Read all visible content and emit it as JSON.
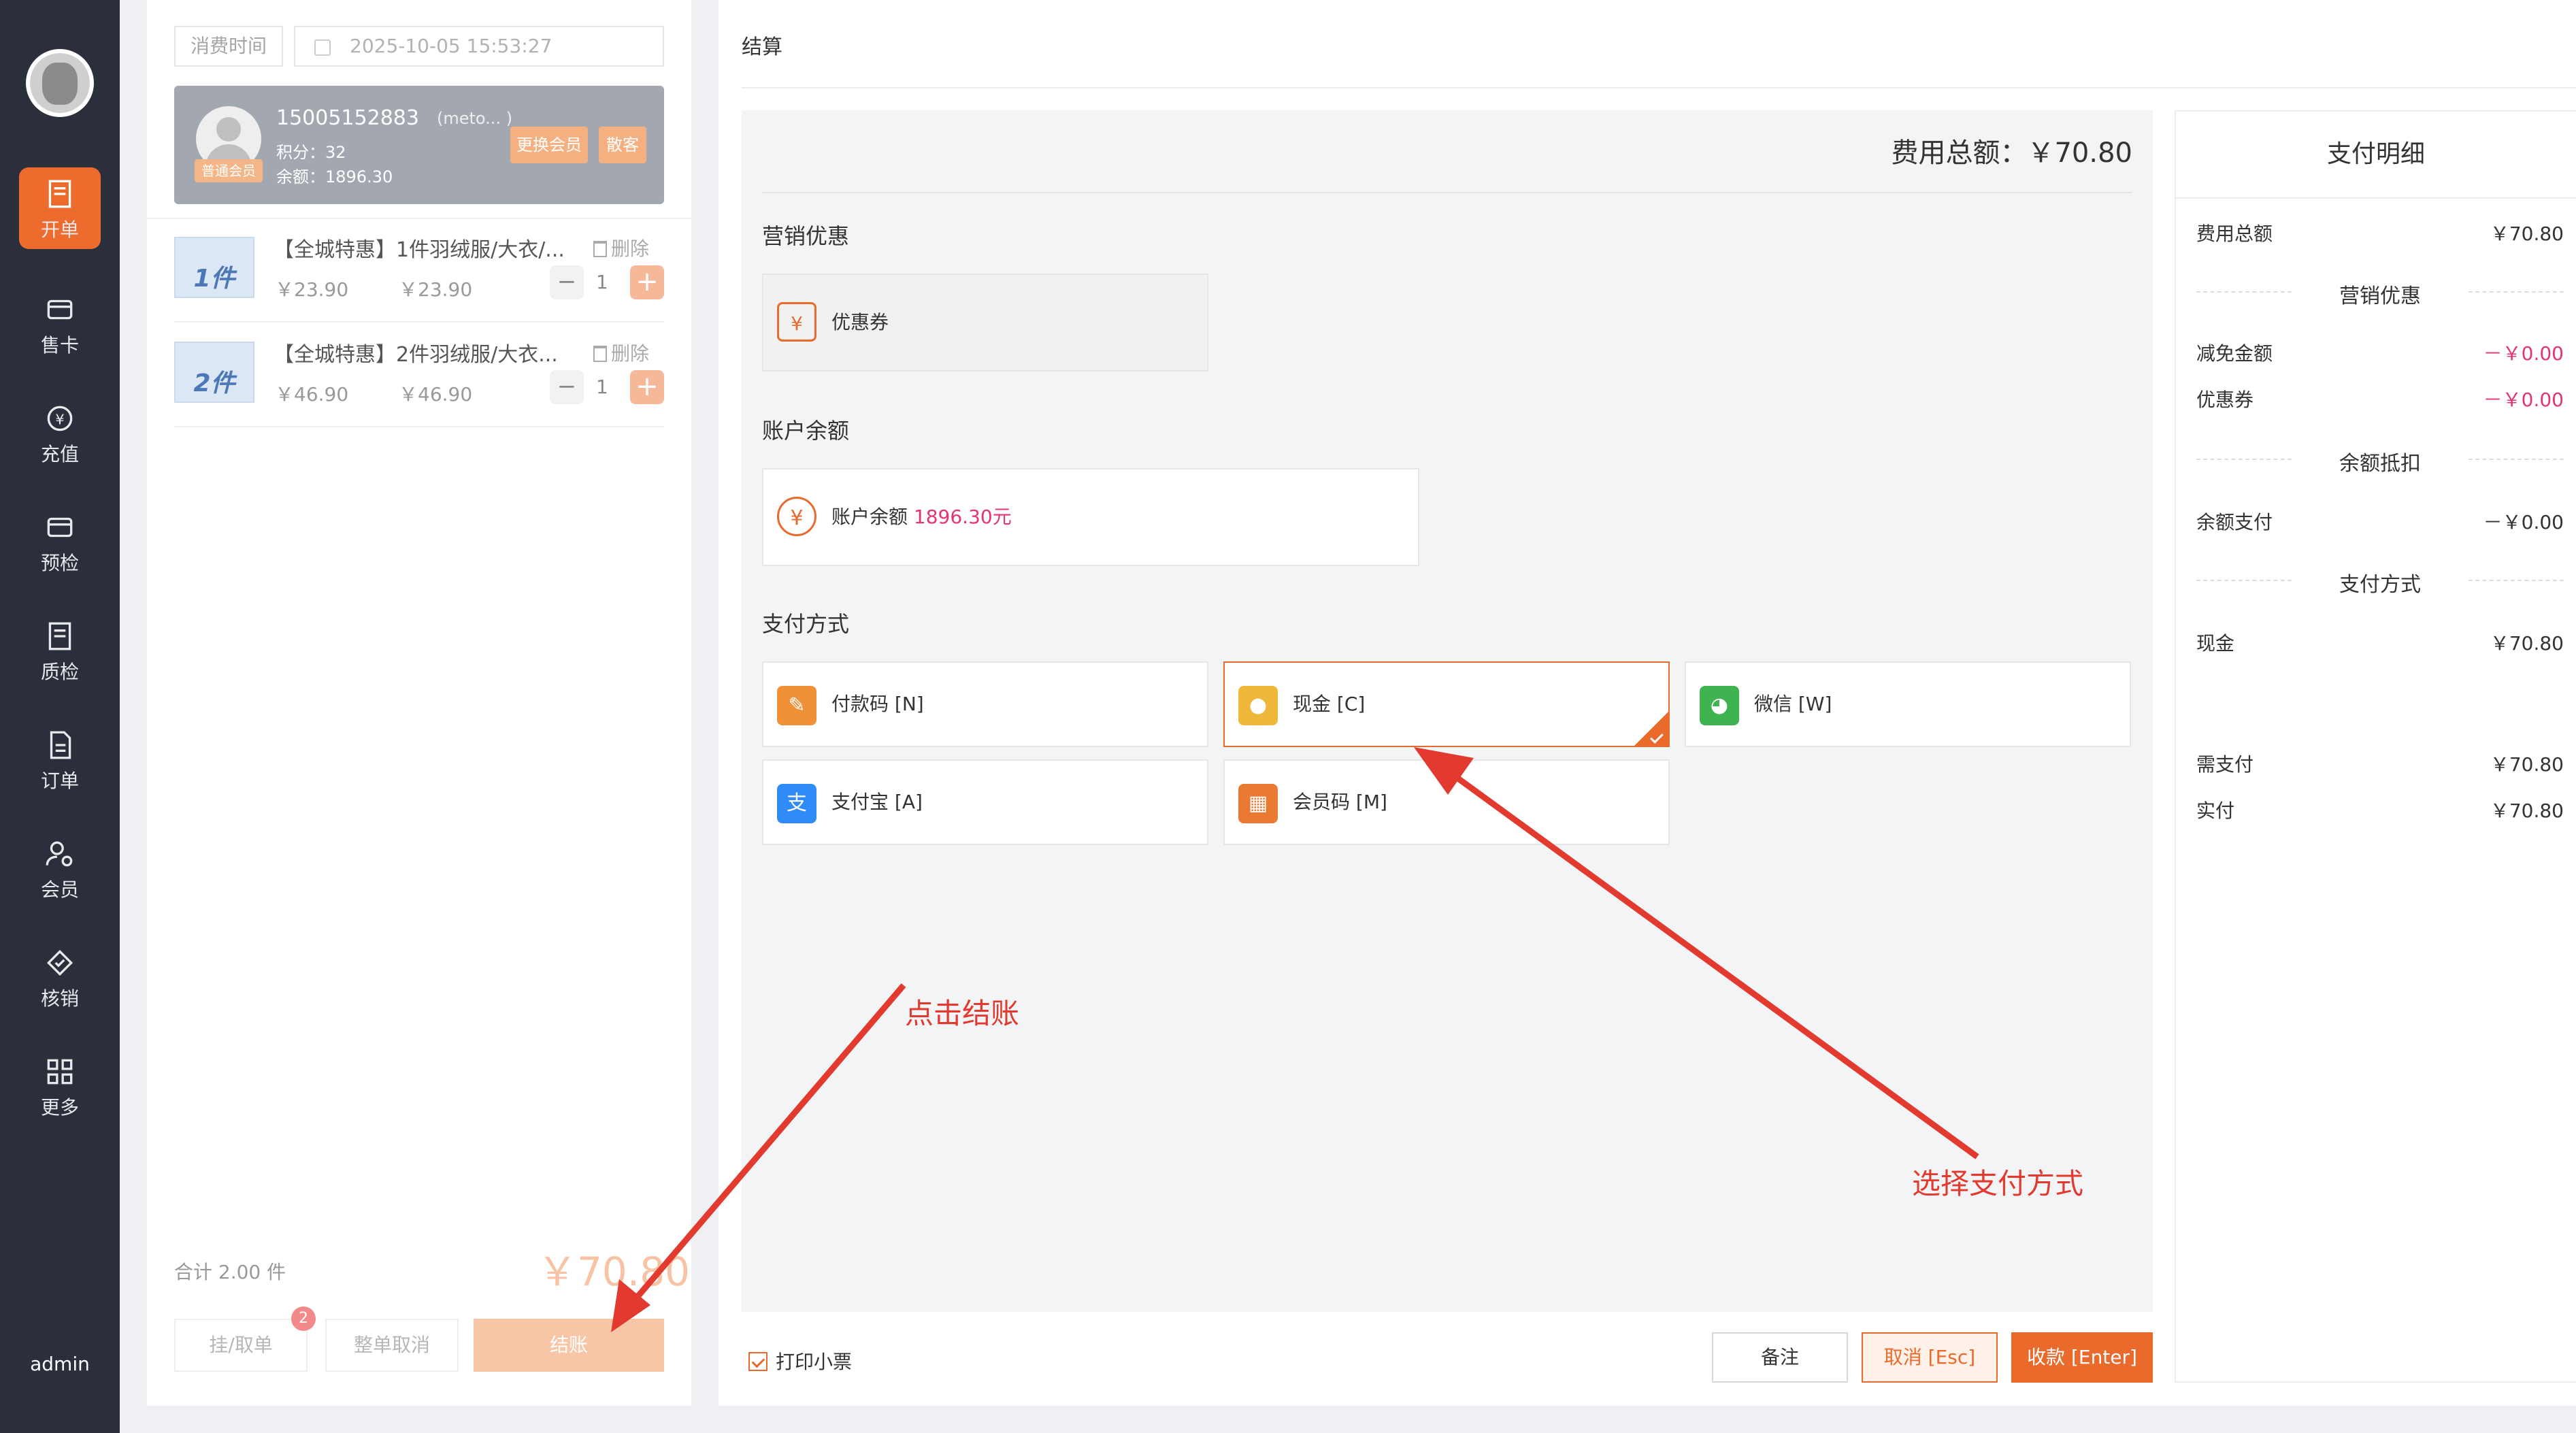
{
  "nav": {
    "items": [
      {
        "label": "开单",
        "active": true
      },
      {
        "label": "售卡"
      },
      {
        "label": "充值"
      },
      {
        "label": "预检"
      },
      {
        "label": "质检"
      },
      {
        "label": "订单"
      },
      {
        "label": "会员"
      },
      {
        "label": "核销"
      },
      {
        "label": "更多"
      }
    ],
    "user": "admin"
  },
  "order": {
    "time_label": "消费时间",
    "time_value": "2025-10-05 15:53:27",
    "member": {
      "phone": "15005152883",
      "alias": "(meto... )",
      "points": "积分：32",
      "balance": "余额：1896.30",
      "level": "普通会员",
      "change_btn": "更换会员",
      "guest_btn": "散客"
    },
    "products": [
      {
        "name": "【全城特惠】1件羽绒服/大衣/...",
        "thumb": "1件",
        "price": "￥23.90",
        "subtotal": "￥23.90",
        "qty": "1",
        "delete": "删除"
      },
      {
        "name": "【全城特惠】2件羽绒服/大衣...",
        "thumb": "2件",
        "price": "￥46.90",
        "subtotal": "￥46.90",
        "qty": "1",
        "delete": "删除"
      }
    ],
    "total_label": "合计 2.00 件",
    "total_amount": "￥70.80",
    "buttons": {
      "hold": "挂/取单",
      "hold_badge": "2",
      "cancel_all": "整单取消",
      "checkout": "结账"
    }
  },
  "checkout": {
    "title": "结算",
    "fee_total": "费用总额：￥70.80",
    "marketing_title": "营销优惠",
    "coupon_label": "优惠券",
    "balance_title": "账户余额",
    "balance_label": "账户余额",
    "balance_amount": "1896.30元",
    "payment_title": "支付方式",
    "payments": [
      {
        "label": "付款码 [N]",
        "color": "#f0913a",
        "icon": "key-icon"
      },
      {
        "label": "现金 [C]",
        "color": "#efb83a",
        "icon": "coin-icon",
        "selected": true
      },
      {
        "label": "微信 [W]",
        "color": "#3fb34f",
        "icon": "wechat-icon"
      },
      {
        "label": "支付宝 [A]",
        "color": "#2f8bf5",
        "icon": "alipay-icon"
      },
      {
        "label": "会员码 [M]",
        "color": "#ea7a33",
        "icon": "grid-icon"
      }
    ],
    "print_label": "打印小票",
    "btn_note": "备注",
    "btn_cancel": "取消 [Esc]",
    "btn_collect": "收款 [Enter]"
  },
  "detail": {
    "title": "支付明细",
    "fee_total_label": "费用总额",
    "fee_total_value": "￥70.80",
    "marketing": "营销优惠",
    "discount_label": "减免金额",
    "discount_value": "－￥0.00",
    "coupon_label": "优惠券",
    "coupon_value": "－￥0.00",
    "balance_section": "余额抵扣",
    "balance_pay_label": "余额支付",
    "balance_pay_value": "－￥0.00",
    "pay_section": "支付方式",
    "cash_label": "现金",
    "cash_value": "￥70.80",
    "need_label": "需支付",
    "need_value": "￥70.80",
    "paid_label": "实付",
    "paid_value": "￥70.80"
  },
  "annotations": {
    "click_checkout": "点击结账",
    "select_payment": "选择支付方式"
  }
}
